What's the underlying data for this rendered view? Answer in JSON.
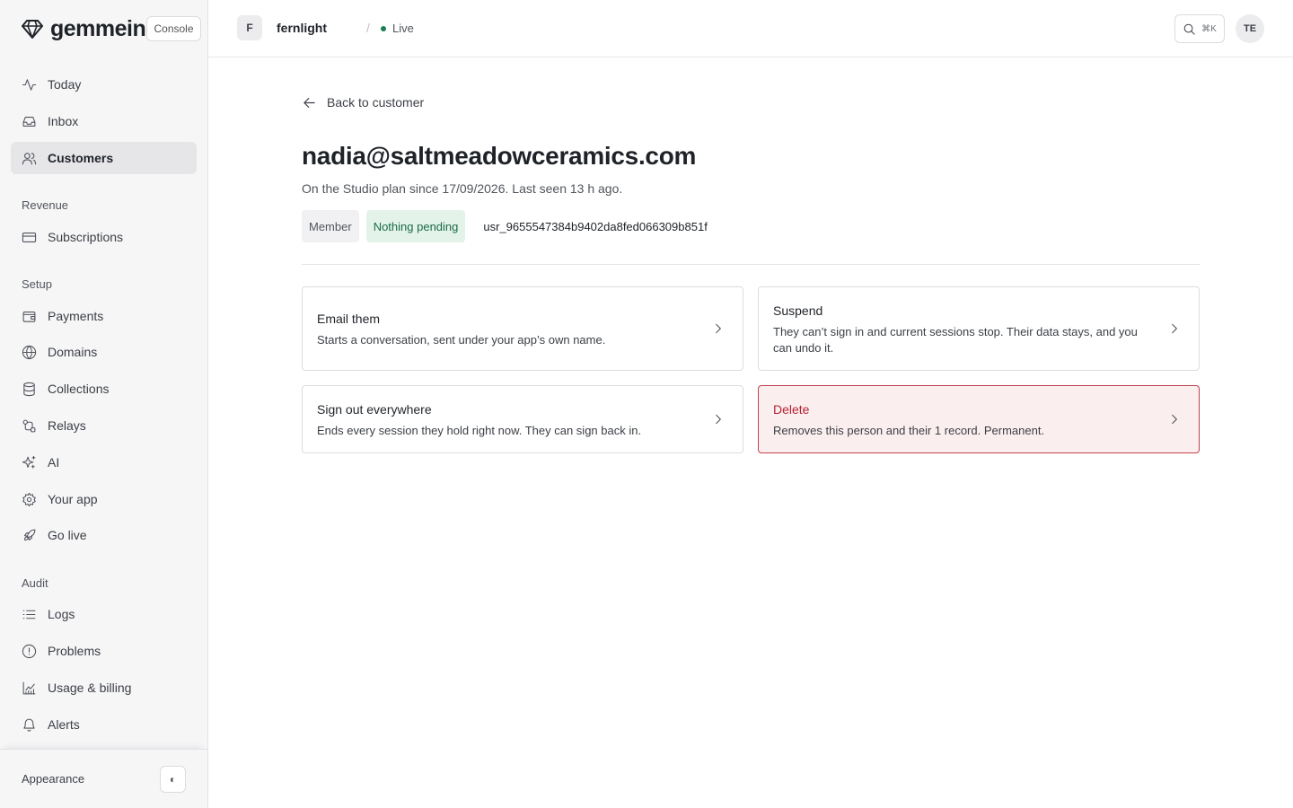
{
  "sidebar": {
    "brand": "gemmein",
    "console_badge": "Console",
    "items_main": [
      {
        "label": "Today",
        "icon": "activity-icon"
      },
      {
        "label": "Inbox",
        "icon": "inbox-icon"
      },
      {
        "label": "Customers",
        "icon": "users-icon",
        "active": true
      }
    ],
    "sections": [
      {
        "label": "Revenue",
        "items": [
          {
            "label": "Subscriptions",
            "icon": "credit-card-icon"
          }
        ]
      },
      {
        "label": "Setup",
        "items": [
          {
            "label": "Payments",
            "icon": "wallet-icon"
          },
          {
            "label": "Domains",
            "icon": "globe-icon"
          },
          {
            "label": "Collections",
            "icon": "database-icon"
          },
          {
            "label": "Relays",
            "icon": "relay-icon"
          },
          {
            "label": "AI",
            "icon": "sparkles-icon"
          },
          {
            "label": "Your app",
            "icon": "gear-icon"
          },
          {
            "label": "Go live",
            "icon": "rocket-icon"
          }
        ]
      },
      {
        "label": "Audit",
        "items": [
          {
            "label": "Logs",
            "icon": "list-icon"
          },
          {
            "label": "Problems",
            "icon": "alert-circle-icon"
          },
          {
            "label": "Usage & billing",
            "icon": "chart-icon"
          },
          {
            "label": "Alerts",
            "icon": "bell-icon"
          }
        ]
      }
    ],
    "footer": {
      "appearance_label": "Appearance",
      "theme_toggle": "◐"
    }
  },
  "topbar": {
    "project_initial": "F",
    "project_name": "fernlight",
    "separator": "/",
    "environment": "Live",
    "search_shortcut": "⌘K",
    "user_initials": "TE"
  },
  "main": {
    "back_label": "Back to customer",
    "title": "nadia@saltmeadowceramics.com",
    "subtitle": "On the Studio plan since 17/09/2026. Last seen 13 h ago.",
    "badges": {
      "role": "Member",
      "status": "Nothing pending"
    },
    "user_id": "usr_9655547384b9402da8fed066309b851f",
    "actions": [
      {
        "title": "Email them",
        "description": "Starts a conversation, sent under your app’s own name."
      },
      {
        "title": "Suspend",
        "description": "They can’t sign in and current sessions stop. Their data stays, and you can undo it."
      },
      {
        "title": "Sign out everywhere",
        "description": "Ends every session they hold right now. They can sign back in."
      },
      {
        "title": "Delete",
        "description": "Removes this person and their 1 record. Permanent."
      }
    ]
  },
  "colors": {
    "accent_live": "#1b7f54",
    "danger": "#b42333",
    "danger_bg": "#fbeeee",
    "pending_bg": "#e3f3ea"
  }
}
